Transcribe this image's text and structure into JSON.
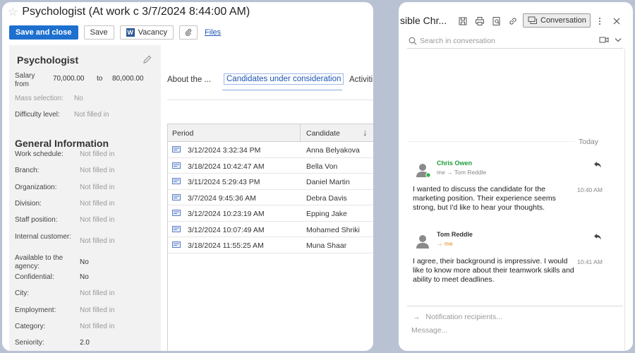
{
  "left": {
    "title": "Psychologist (At work c 3/7/2024 8:44:00 AM)",
    "toolbar": {
      "save_close": "Save and close",
      "save": "Save",
      "vacancy": "Vacancy",
      "vacancy_badge": "W",
      "files": "Files"
    },
    "side": {
      "header": "Psychologist",
      "salary_label": "Salary from",
      "salary_from": "70,000.00",
      "salary_to_label": "to",
      "salary_to": "80,000.00",
      "mass_selection_label": "Mass selection:",
      "mass_selection_value": "No",
      "difficulty_label": "Difficulty level:",
      "difficulty_value": "Not filled in",
      "general_header": "General Information",
      "fields": [
        {
          "label": "Work schedule:",
          "value": "Not filled in"
        },
        {
          "label": "Branch:",
          "value": "Not filled in"
        },
        {
          "label": "Organization:",
          "value": "Not filled in"
        },
        {
          "label": "Division:",
          "value": "Not filled in"
        },
        {
          "label": "Staff position:",
          "value": "Not filled in"
        },
        {
          "label": "Internal customer:",
          "value": "Not filled in"
        },
        {
          "label": "Available to the agency:",
          "value": "No"
        },
        {
          "label": "Confidential:",
          "value": "No"
        },
        {
          "label": "City:",
          "value": "Not filled in"
        },
        {
          "label": "Employment:",
          "value": "Not filled in"
        },
        {
          "label": "Category:",
          "value": "Not filled in"
        },
        {
          "label": "Seniority:",
          "value": "2.0"
        }
      ]
    },
    "tabs": [
      "About the ...",
      "Candidates under consideration",
      "Activiti"
    ],
    "table": {
      "headers": [
        "Period",
        "Candidate"
      ],
      "sort_icon": "↓",
      "rows": [
        {
          "period": "3/12/2024 3:32:34 PM",
          "candidate": "Anna Belyakova"
        },
        {
          "period": "3/18/2024 10:42:47 AM",
          "candidate": "Bella Von"
        },
        {
          "period": "3/11/2024 5:29:43 PM",
          "candidate": "Daniel Martin"
        },
        {
          "period": "3/7/2024 9:45:36 AM",
          "candidate": "Debra  Davis"
        },
        {
          "period": "3/12/2024 10:23:19 AM",
          "candidate": "Epping Jake"
        },
        {
          "period": "3/12/2024 10:07:49 AM",
          "candidate": "Mohamed Shriki"
        },
        {
          "period": "3/18/2024 11:55:25 AM",
          "candidate": "Muna  Shaar"
        }
      ]
    }
  },
  "right": {
    "title": "sible Chr...",
    "conversation_label": "Conversation",
    "search_placeholder": "Search in conversation",
    "today": "Today",
    "messages": [
      {
        "sender": "Chris Owen",
        "route": "me → Tom Reddle",
        "text": "I wanted to discuss the candidate for the marketing position. Their experience seems strong, but I'd like to hear your thoughts.",
        "time": "10:40 AM"
      },
      {
        "sender": "Tom Reddle",
        "route": "→ me",
        "text": "I agree, their background is impressive. I would like to know more about their teamwork skills and ability to meet deadlines.",
        "time": "10:41 AM"
      }
    ],
    "notification_placeholder": "Notification recipients...",
    "message_placeholder": "Message..."
  },
  "colors": {
    "background": "#b9c2d3",
    "primary_button": "#1e70cf",
    "link": "#1e55b3",
    "online_dot": "#2eb84b",
    "sender_green": "#1f9d3a",
    "route_orange": "#e08a1e"
  },
  "icons": [
    "star-icon",
    "paperclip-icon",
    "pencil-icon",
    "sort-down-icon",
    "record-icon",
    "save-icon",
    "print-icon",
    "preview-icon",
    "link-icon",
    "conversation-icon",
    "kebab-icon",
    "close-icon",
    "search-icon",
    "video-icon",
    "chevron-down-icon",
    "avatar-icon",
    "reply-icon",
    "arrow-right-icon"
  ]
}
